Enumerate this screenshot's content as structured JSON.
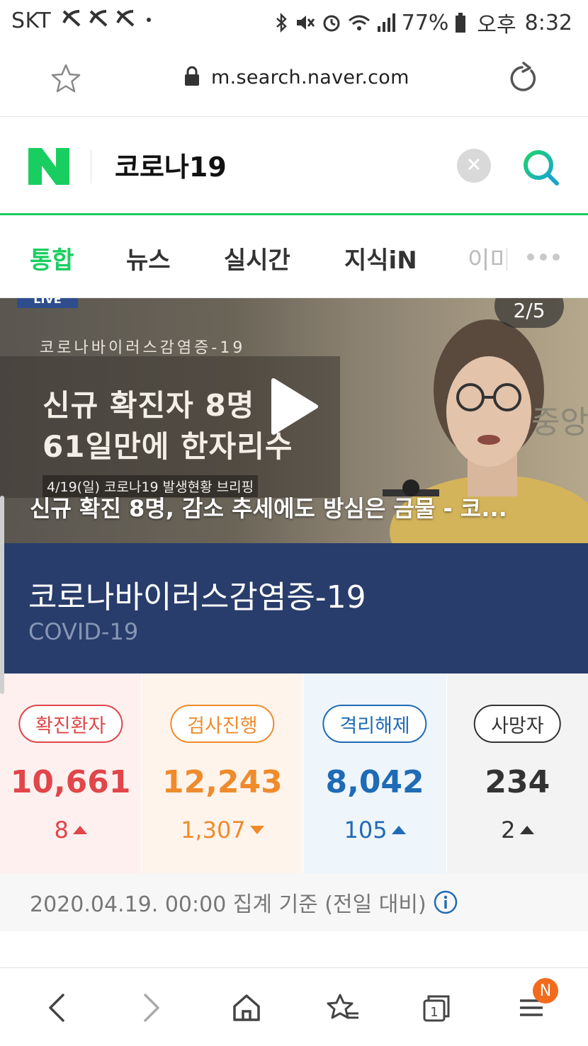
{
  "status_bar": {
    "carrier": "SKT",
    "battery_percent": "77%",
    "ampm": "오후",
    "time": "8:32"
  },
  "browser": {
    "url": "m.search.naver.com"
  },
  "search": {
    "query": "코로나19"
  },
  "tabs": [
    {
      "label": "통합",
      "active": true
    },
    {
      "label": "뉴스",
      "active": false
    },
    {
      "label": "실시간",
      "active": false
    },
    {
      "label": "지식iN",
      "active": false
    },
    {
      "label": "이미",
      "active": false
    }
  ],
  "video": {
    "page_counter": "2/5",
    "live_tag": "LIVE",
    "subtitle": "코로나바이러스감염증-19",
    "headline_line1": "신규 확진자 8명",
    "headline_line2": "61일만에 한자리수",
    "briefing": "4/19(일) 코로나19 발생현황 브리핑",
    "caption": "신규 확진 8명, 감소 추세에도 방심은 금물 - 코..."
  },
  "disease": {
    "title_ko": "코로나바이러스감염증-19",
    "title_en": "COVID-19"
  },
  "stats": [
    {
      "label": "확진환자",
      "value": "10,661",
      "delta": "8",
      "direction": "up",
      "color": "#e0464a",
      "bg": "#fdf0ef"
    },
    {
      "label": "검사진행",
      "value": "12,243",
      "delta": "1,307",
      "direction": "down",
      "color": "#ef8b2c",
      "bg": "#fef4ec"
    },
    {
      "label": "격리해제",
      "value": "8,042",
      "delta": "105",
      "direction": "up",
      "color": "#1f6bb5",
      "bg": "#eef5fb"
    },
    {
      "label": "사망자",
      "value": "234",
      "delta": "2",
      "direction": "up",
      "color": "#333333",
      "bg": "#f3f3f3"
    }
  ],
  "basis_text": "2020.04.19. 00:00 집계 기준 (전일 대비)",
  "bottom_nav": {
    "badge": "N"
  },
  "colors": {
    "naver_green": "#19ce60",
    "title_bg": "#283d6b"
  }
}
